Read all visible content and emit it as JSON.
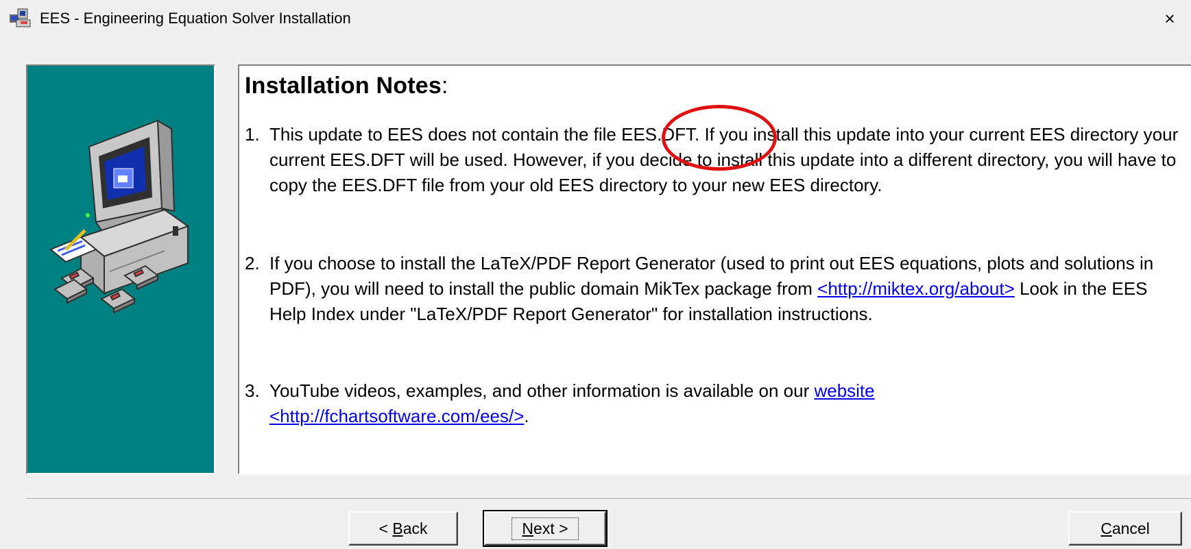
{
  "window": {
    "title": "EES - Engineering Equation Solver Installation",
    "close_label": "×"
  },
  "notes": {
    "title": "Installation Notes",
    "title_colon": ":",
    "items": [
      {
        "number": "1.",
        "text": "This update to EES does not contain the file EES.DFT.  If you install this update into your current EES directory your current EES.DFT will be used.  However, if you decide to install this update into a different directory, you will have to copy the EES.DFT file from your old EES directory to your new EES directory."
      },
      {
        "number": "2.",
        "text_before_link": "If you choose to install the LaTeX/PDF Report Generator (used to print out EES equations, plots and solutions in PDF), you will need to install the public domain MikTex package from ",
        "link": "<http://miktex.org/about>",
        "text_after_link": "   Look in the EES Help Index under \"LaTeX/PDF Report Generator\" for installation instructions."
      },
      {
        "number": "3.",
        "text_before_link": "YouTube videos, examples, and other information is available on our ",
        "link1": "website",
        "link2": "<http://fchartsoftware.com/ees/>",
        "text_after_link": "."
      }
    ]
  },
  "buttons": {
    "back": {
      "prefix": "< ",
      "mnemonic": "B",
      "rest": "ack"
    },
    "next": {
      "mnemonic": "N",
      "rest": "ext >"
    },
    "cancel": {
      "mnemonic": "C",
      "rest": "ancel"
    }
  },
  "annotation": {
    "color": "#e01010",
    "target": "EES.DFT."
  },
  "colors": {
    "side_panel": "#008080",
    "link": "#0000ee"
  }
}
